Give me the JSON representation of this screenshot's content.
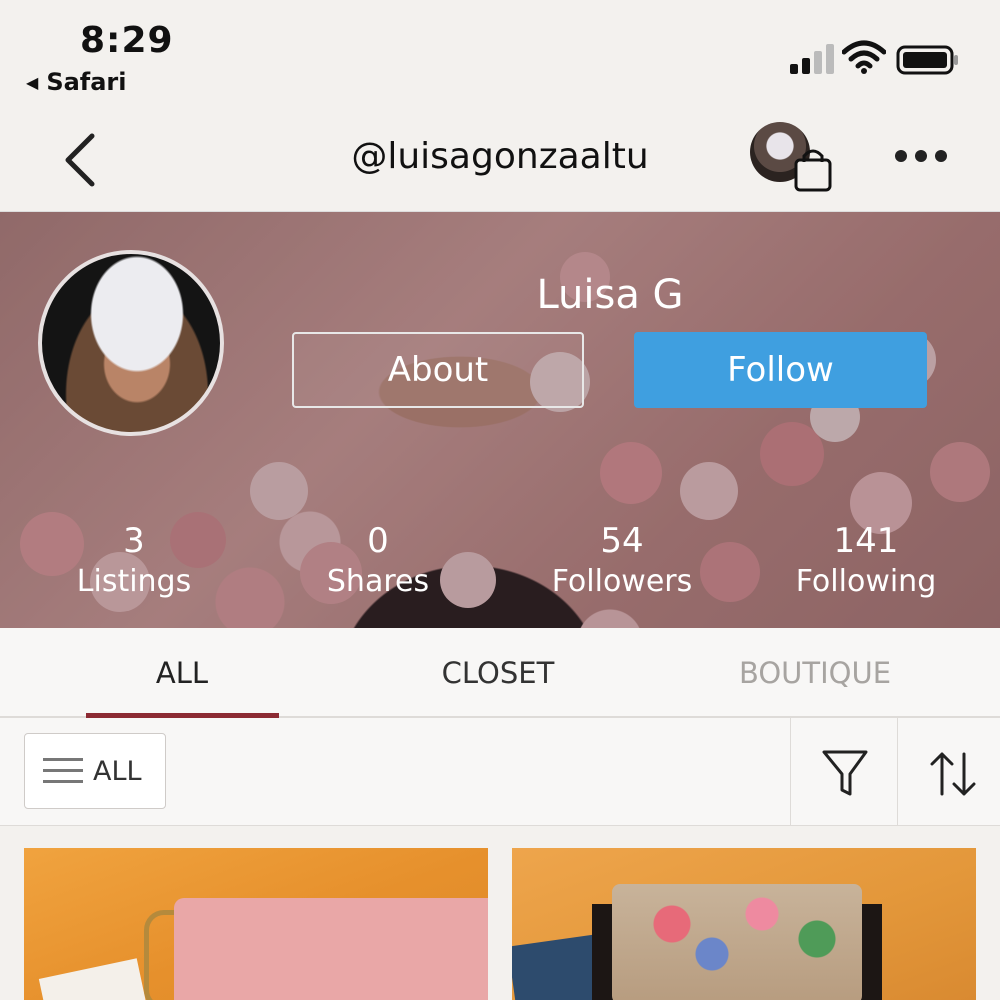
{
  "status_bar": {
    "time": "8:29",
    "back_app": "Safari",
    "back_app_icon": "left-triangle-icon",
    "icons": [
      "cellular-signal-icon",
      "wifi-icon",
      "battery-icon"
    ]
  },
  "nav": {
    "title": "@luisagonzaaltu",
    "back_icon": "chevron-left-icon",
    "bag_icon": "shopping-bag-icon",
    "more_icon": "more-horizontal-icon"
  },
  "profile": {
    "name": "Luisa G",
    "about_label": "About",
    "follow_label": "Follow",
    "follow_color": "#3f9fe0",
    "stats": [
      {
        "value": "3",
        "label": "Listings"
      },
      {
        "value": "0",
        "label": "Shares"
      },
      {
        "value": "54",
        "label": "Followers"
      },
      {
        "value": "141",
        "label": "Following"
      }
    ]
  },
  "tabs": [
    {
      "label": "ALL",
      "active": true
    },
    {
      "label": "CLOSET",
      "active": false
    },
    {
      "label": "BOUTIQUE",
      "active": false
    }
  ],
  "accent_color": "#8c2a33",
  "filter": {
    "category_label": "ALL",
    "category_icon": "hamburger-menu-icon",
    "filter_icon": "funnel-icon",
    "sort_icon": "sort-arrows-icon"
  }
}
